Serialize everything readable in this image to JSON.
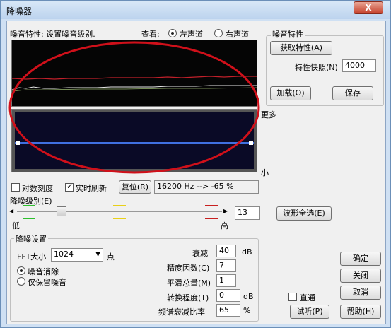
{
  "window": {
    "title": "降噪器",
    "close_label": "X"
  },
  "profile": {
    "caption": "噪音特性: 设置噪音级别.",
    "view_label": "查看:",
    "left_channel": "左声道",
    "right_channel": "右声道",
    "more_label": "更多",
    "less_label": "小"
  },
  "noise_profile": {
    "title": "噪音特性",
    "get_button": "获取特性(A)",
    "snapshot_label": "特性快照(N)",
    "snapshot_value": "4000",
    "load_button": "加载(O)",
    "save_button": "保存"
  },
  "options": {
    "log_scale": "对数刻度",
    "realtime": "实时刷新",
    "reset_button": "复位(R)",
    "freq_readout": "16200 Hz --> -65 %"
  },
  "level": {
    "title": "降噪级别(E)",
    "low": "低",
    "high": "高",
    "value": "13",
    "slider_fraction": 0.13,
    "select_all_button": "波形全选(E)"
  },
  "settings": {
    "title": "降噪设置",
    "fft_label": "FFT大小",
    "fft_value": "1024",
    "points_label": "点",
    "radio_remove": "噪音消除",
    "radio_keep": "仅保留噪音",
    "attenuation_label": "衰减",
    "attenuation_value": "40",
    "attenuation_unit": "dB",
    "precision_label": "精度因数(C)",
    "precision_value": "7",
    "smoothing_label": "平滑总量(M)",
    "smoothing_value": "1",
    "transition_label": "转换程度(T)",
    "transition_value": "0",
    "transition_unit": "dB",
    "spectral_label": "频谱衰减比率",
    "spectral_value": "65",
    "spectral_unit": "%"
  },
  "actions": {
    "ok": "确定",
    "close": "关闭",
    "cancel": "取消",
    "bypass": "直通",
    "preview": "试听(P)",
    "help": "帮助(H)"
  },
  "colors": {
    "graph_bg": "#050505",
    "red_curve": "#c0202a",
    "white_curve": "#e8e8e8",
    "curve_panel_bg": "#0a0a26",
    "blue_line": "#4070e0",
    "annotation_red": "#d0101a",
    "marker_green": "#2ec02e",
    "marker_yellow": "#e8d018",
    "marker_red": "#c82020"
  }
}
